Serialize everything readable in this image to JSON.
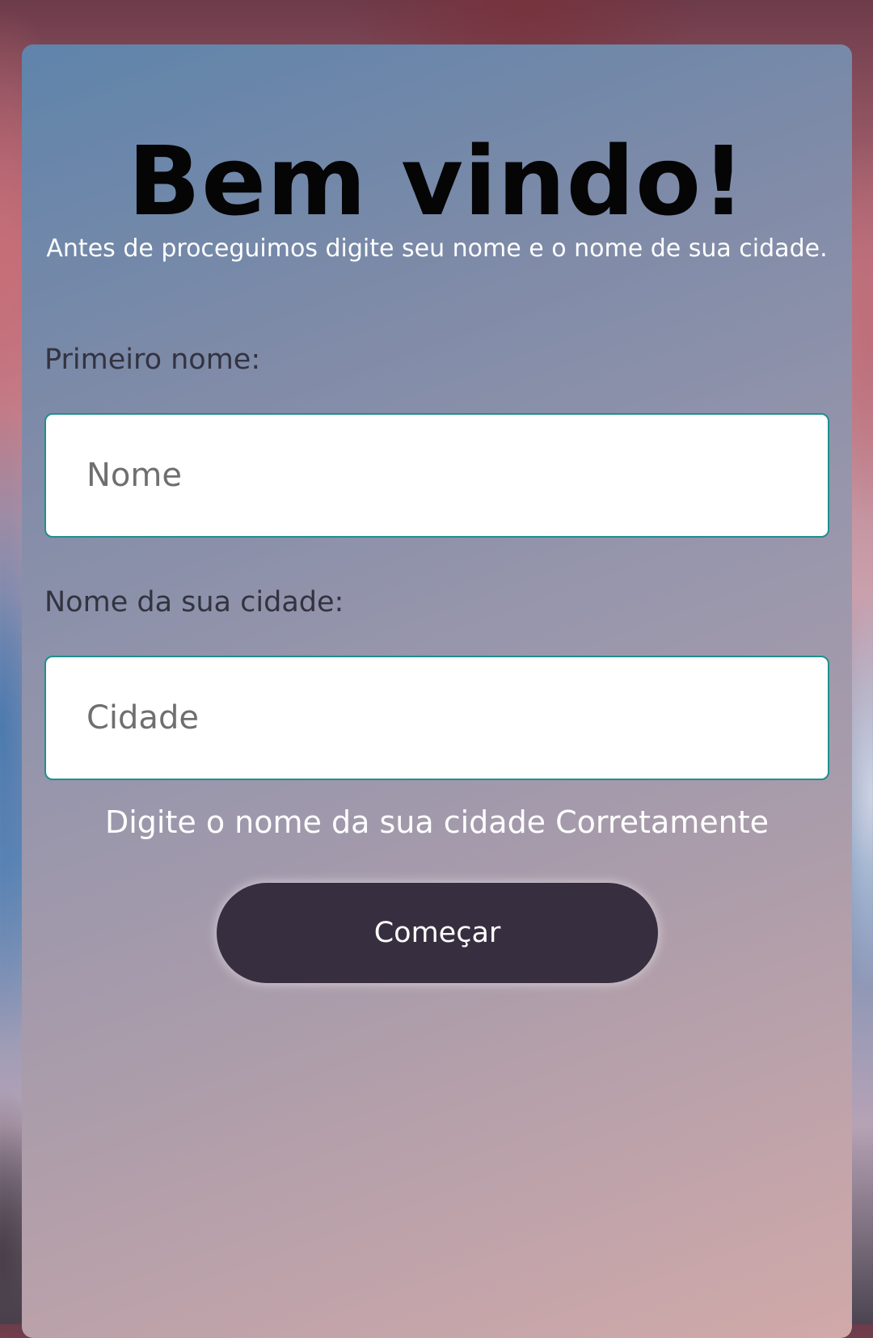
{
  "welcome": {
    "title": "Bem vindo!",
    "subtitle": "Antes de proceguimos digite seu nome e o nome de sua cidade."
  },
  "form": {
    "name_label": "Primeiro nome:",
    "name_placeholder": "Nome",
    "city_label": "Nome da sua cidade:",
    "city_placeholder": "Cidade",
    "hint": "Digite o nome da sua cidade Corretamente",
    "submit_label": "Começar"
  },
  "colors": {
    "button_bg": "#372f3f",
    "input_border": "#1f8f8f",
    "title_text": "#050506"
  }
}
